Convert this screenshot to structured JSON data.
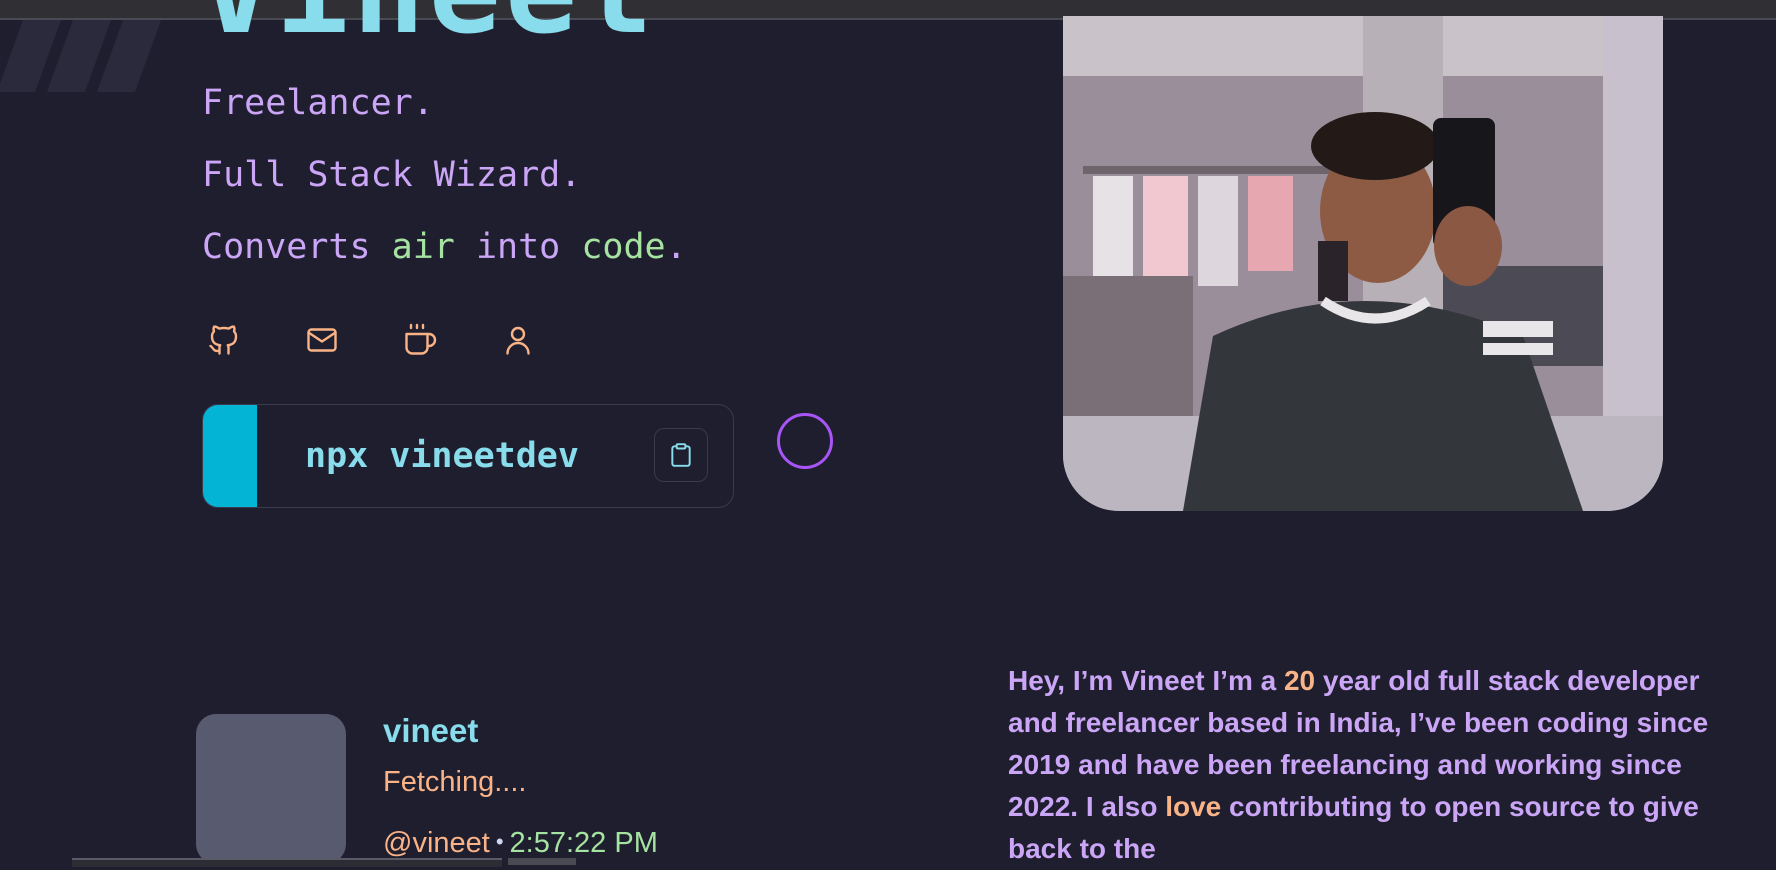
{
  "hero": {
    "name": "Vineet",
    "taglines": {
      "line1": "Freelancer.",
      "line2": "Full Stack Wizard.",
      "line3_pre": "Converts ",
      "line3_hl1": "air",
      "line3_mid": " into ",
      "line3_hl2": "code",
      "line3_post": "."
    }
  },
  "socials": [
    {
      "name": "github-icon"
    },
    {
      "name": "mail-icon"
    },
    {
      "name": "coffee-icon"
    },
    {
      "name": "user-icon"
    }
  ],
  "command": {
    "text": "npx vineetdev",
    "copy_icon": "clipboard-icon"
  },
  "discord": {
    "username": "vineet",
    "status": "Fetching....",
    "handle": "@vineet",
    "separator": "•",
    "time": "2:57:22 PM"
  },
  "bio": {
    "p1": "Hey, I’m Vineet I’m a ",
    "age": "20",
    "p2": " year old full stack developer and freelancer based in India, I’ve been coding since 2019 and have been freelancing and working since 2022. I also ",
    "love": "love",
    "p3": " contributing to open source to give back to the"
  },
  "colors": {
    "background": "#1e1e2e",
    "lavender": "#cba6f7",
    "cyan": "#89dceb",
    "peach": "#fab387",
    "green": "#a6e3a1",
    "accent_bar": "#04b4d4",
    "ring": "#a855f7"
  }
}
